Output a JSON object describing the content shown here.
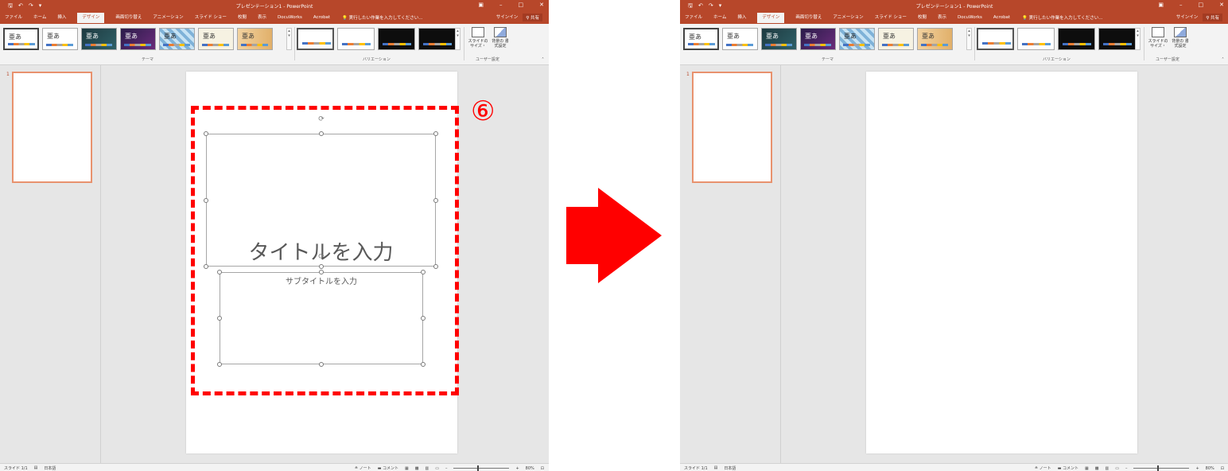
{
  "app": {
    "window_title": "プレゼンテーション1 - PowerPoint",
    "tabs": [
      "ファイル",
      "ホーム",
      "挿入",
      "デザイン",
      "画面切り替え",
      "アニメーション",
      "スライド ショー",
      "校閲",
      "表示",
      "DocuWorks",
      "Acrobat"
    ],
    "active_tab": "デザイン",
    "tell_me": "実行したい作業を入力してください...",
    "sign_in": "サインイン",
    "share": "共有",
    "theme_glyphs": [
      "亜あ",
      "亜あ",
      "亜あ",
      "亜あ",
      "亜あ",
      "亜あ",
      "亜あ"
    ],
    "group_labels": {
      "themes": "テーマ",
      "variants": "バリエーション",
      "customize": "ユーザー設定"
    },
    "customize_buttons": {
      "slide_size": "スライドの サイズ・",
      "format_background": "背景の 書式設定"
    },
    "status": {
      "slide": "スライド 1/1",
      "language": "日本語",
      "notes": "ノート",
      "comments": "コメント",
      "zoom": "80%"
    },
    "thumb_number": "1"
  },
  "left_slide": {
    "title_placeholder": "タイトルを入力",
    "subtitle_placeholder": "サブタイトルを入力"
  },
  "annotation": {
    "step_marker": "⑥",
    "color": "#ff0000"
  },
  "colors": {
    "accent": "#b7472a",
    "ribbon": "#f3f3f3",
    "workspace": "#e6e6e6",
    "thumb_border": "#e8926e"
  }
}
